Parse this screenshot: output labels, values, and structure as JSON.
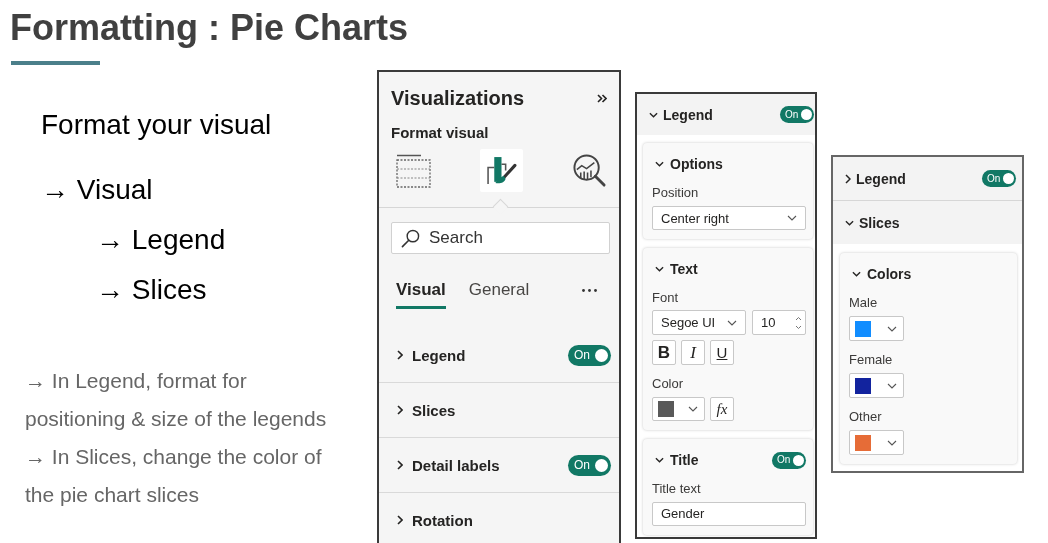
{
  "slide": {
    "title": "Formatting : Pie Charts"
  },
  "outline": {
    "heading": "Format your visual",
    "items": [
      {
        "label": "→ Visual",
        "children": [
          {
            "label": "→ Legend"
          },
          {
            "label": "→ Slices"
          }
        ]
      }
    ]
  },
  "notes": [
    "→ In Legend, format for positioning & size of the legends",
    "→ In Slices, change the color of the pie chart slices"
  ],
  "visualizations_pane": {
    "title": "Visualizations",
    "subtitle": "Format visual",
    "modes": [
      {
        "kind": "fields",
        "selected": false
      },
      {
        "kind": "format",
        "selected": true
      },
      {
        "kind": "analytics",
        "selected": false
      }
    ],
    "search": {
      "placeholder": "Search"
    },
    "tabs": [
      {
        "label": "Visual",
        "selected": true
      },
      {
        "label": "General",
        "selected": false
      }
    ],
    "sections": [
      {
        "label": "Legend",
        "expanded": false,
        "toggle": {
          "label": "On",
          "on": true
        }
      },
      {
        "label": "Slices",
        "expanded": false
      },
      {
        "label": "Detail labels",
        "expanded": false,
        "toggle": {
          "label": "On",
          "on": true
        }
      },
      {
        "label": "Rotation",
        "expanded": false
      }
    ]
  },
  "legend_pane": {
    "sections": [
      {
        "label": "Legend",
        "expanded": true,
        "toggle": {
          "label": "On",
          "on": true
        }
      }
    ],
    "cards": [
      {
        "title": "Options",
        "expanded": true,
        "fields": [
          {
            "kind": "dropdown",
            "label": "Position",
            "value": "Center right"
          }
        ]
      },
      {
        "title": "Text",
        "expanded": true,
        "fields": [
          {
            "kind": "font",
            "label": "Font",
            "family": "Segoe UI",
            "size": "10",
            "styles": [
              {
                "kind": "bold",
                "label": "B"
              },
              {
                "kind": "italic",
                "label": "I"
              },
              {
                "kind": "underline",
                "label": "U"
              }
            ]
          },
          {
            "kind": "color",
            "label": "Color",
            "color": "#595959",
            "fx": "fx"
          }
        ]
      },
      {
        "title": "Title",
        "expanded": true,
        "toggle": {
          "label": "On",
          "on": true
        },
        "fields": [
          {
            "kind": "text",
            "label": "Title text",
            "value": "Gender"
          }
        ]
      }
    ]
  },
  "slices_pane": {
    "sections": [
      {
        "label": "Legend",
        "expanded": false,
        "toggle": {
          "label": "On",
          "on": true
        }
      },
      {
        "label": "Slices",
        "expanded": true
      }
    ],
    "cards": [
      {
        "title": "Colors",
        "expanded": true,
        "fields": [
          {
            "kind": "color",
            "label": "Male",
            "color": "#118dff"
          },
          {
            "kind": "color",
            "label": "Female",
            "color": "#12239e"
          },
          {
            "kind": "color",
            "label": "Other",
            "color": "#e66c37"
          }
        ]
      }
    ]
  }
}
